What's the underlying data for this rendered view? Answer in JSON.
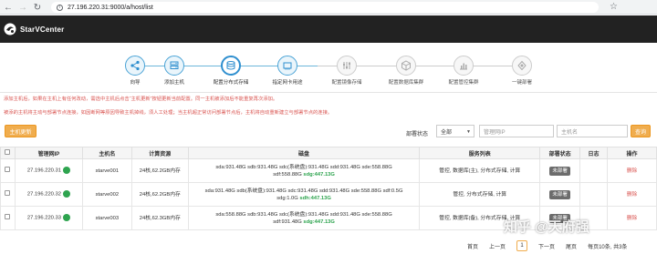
{
  "browser": {
    "url": "27.196.220.31:9000/a/host/list"
  },
  "app": {
    "name": "StarVCenter"
  },
  "wizard": {
    "steps": [
      {
        "label": "向导",
        "state": "done"
      },
      {
        "label": "添加主机",
        "state": "done"
      },
      {
        "label": "配置分布式存储",
        "state": "current"
      },
      {
        "label": "指定网卡用途",
        "state": "done"
      },
      {
        "label": "配置镜像存储",
        "state": "todo"
      },
      {
        "label": "配置数据库集群",
        "state": "todo"
      },
      {
        "label": "配置管控集群",
        "state": "todo"
      },
      {
        "label": "一键部署",
        "state": "todo"
      }
    ]
  },
  "notice": {
    "line1": "添加主机后，如果在主机上有任何改动，需选中主机后点击“主机更新”按钮更新当前配置。同一主机被添加后不能重复再次添加。",
    "line2": "被添的主机将主动与部署节点连接，如因断网等原因导致主机掉线，须人工处理；当主机超正常访问部署节点后，主机将自动重新建立与部署节点的连接。"
  },
  "toolbar": {
    "update_button": "主机更新",
    "status_label": "部署状态",
    "status_value": "全部",
    "mgmt_ip_placeholder": "管理网IP",
    "hostname_placeholder": "主机名",
    "search_button": "查询"
  },
  "table": {
    "headers": [
      "",
      "管理网IP",
      "主机名",
      "计算资源",
      "磁盘",
      "服务列表",
      "部署状态",
      "日志",
      "操作"
    ],
    "rows": [
      {
        "ip": "27.196.220.31",
        "hostname": "starve001",
        "compute": "24核,62.2GB内存",
        "disk_line1": "sda:931.48G sdb:931.48G sdc(系统盘):931.48G sdd:931.48G sde:558.88G",
        "disk_line2": "sdf:558.88G",
        "disk_sdg": "sdg:447.13G",
        "services": "管控, 数据库(主), 分布式存储, 计算",
        "status": "未部署",
        "log": "",
        "action": "删除"
      },
      {
        "ip": "27.196.220.32",
        "hostname": "starve002",
        "compute": "24核,62.2GB内存",
        "disk_line1": "sda:931.48G sdb(系统盘):931.48G sdc:931.48G sdd:931.48G sde:558.88G sdf:0.5G",
        "disk_line2": "sdg:1.0G",
        "disk_sdg": "sdh:447.13G",
        "services": "管控, 分布式存储, 计算",
        "status": "未部署",
        "log": "",
        "action": "删除"
      },
      {
        "ip": "27.196.220.33",
        "hostname": "starve003",
        "compute": "24核,62.3GB内存",
        "disk_line1": "sda:558.88G sdb:931.48G sdc(系统盘):931.48G sdd:931.48G sde:558.88G",
        "disk_line2": "sdf:931.48G",
        "disk_sdg": "sdg:447.13G",
        "services": "管控, 数据库(备), 分布式存储, 计算",
        "status": "未部署",
        "log": "",
        "action": "删除"
      }
    ]
  },
  "pager": {
    "first": "首页",
    "prev": "上一页",
    "current": "1",
    "next": "下一页",
    "last": "尾页",
    "info": "每页10条, 共3条"
  },
  "watermark": "知乎 @天府强",
  "colors": {
    "accent": "#f0ad4e",
    "online": "#2ea44f",
    "danger": "#d9534f",
    "wizard": "#4aa3d6"
  }
}
